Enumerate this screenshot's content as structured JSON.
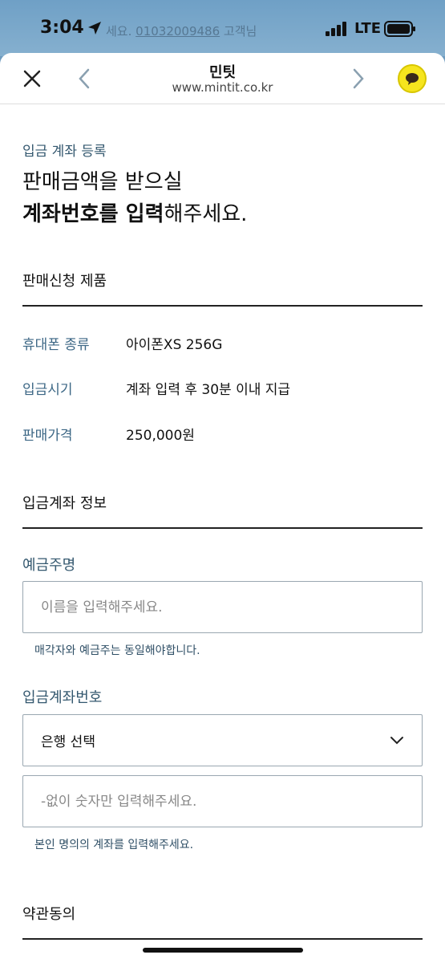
{
  "status_bar": {
    "time": "3:04",
    "banner_text": "세요.",
    "banner_phone": "01032009486",
    "banner_suffix": "고객님",
    "network": "LTE"
  },
  "browser": {
    "title": "민팃",
    "url": "www.mintit.co.kr",
    "chat_color": "#f6e51e"
  },
  "page": {
    "section_label": "입금 계좌 등록",
    "headline_line1": "판매금액을 받으실",
    "headline_bold": "계좌번호를 입력",
    "headline_rest": "해주세요.",
    "product_section_title": "판매신청 제품",
    "product_rows": [
      {
        "label": "휴대폰 종류",
        "value": "아이폰XS 256G"
      },
      {
        "label": "입금시기",
        "value": "계좌 입력 후 30분 이내 지급"
      },
      {
        "label": "판매가격",
        "value": "250,000원"
      }
    ],
    "account_section_title": "입금계좌 정보",
    "depositor_label": "예금주명",
    "depositor_placeholder": "이름을 입력해주세요.",
    "depositor_hint": "매각자와 예금주는 동일해야합니다.",
    "account_number_label": "입금계좌번호",
    "bank_select_value": "은행 선택",
    "account_placeholder": "-없이 숫자만 입력해주세요.",
    "account_hint": "본인 명의의 계좌를 입력해주세요.",
    "terms_section_title": "약관동의"
  }
}
